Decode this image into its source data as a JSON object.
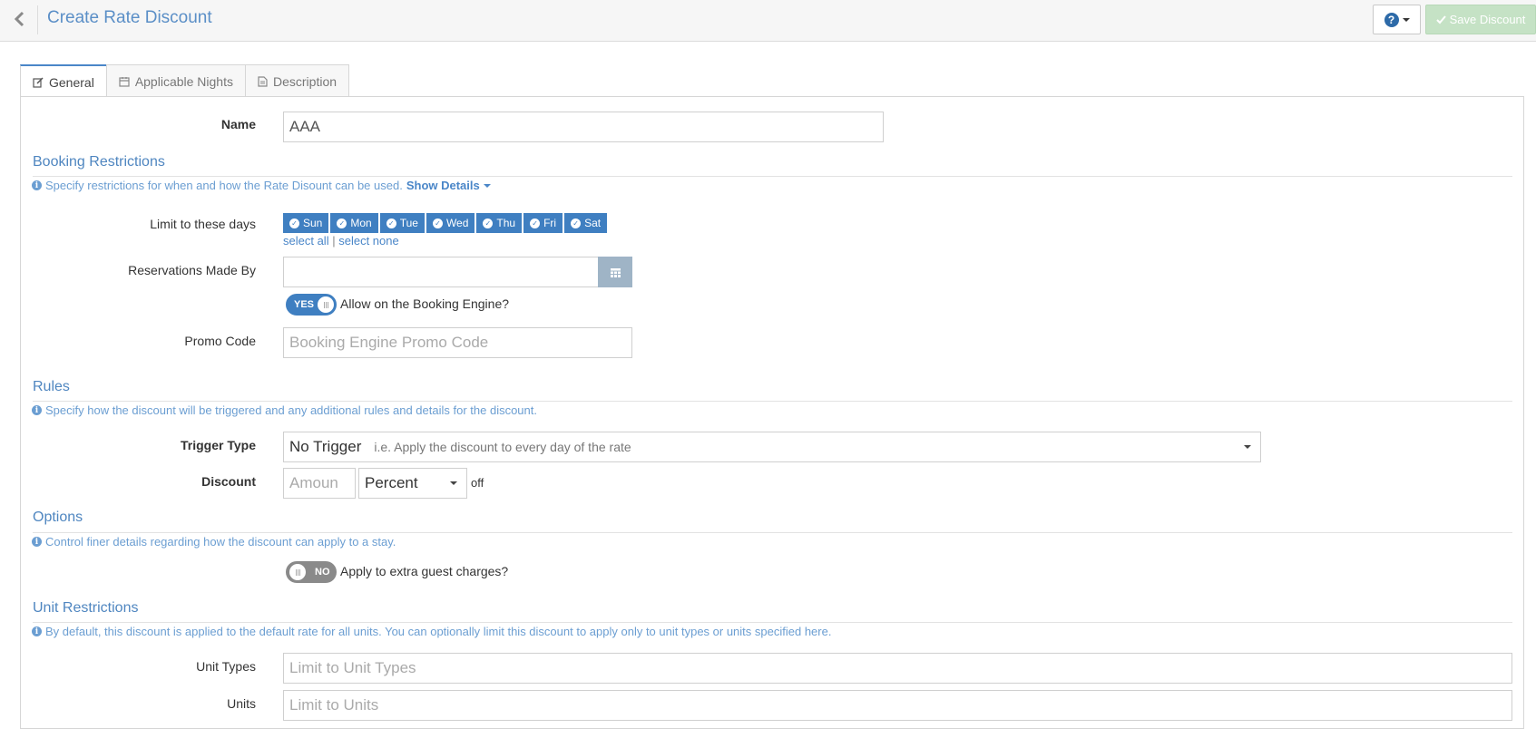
{
  "header": {
    "title": "Create Rate Discount",
    "save_label": "Save Discount"
  },
  "tabs": [
    {
      "label": "General",
      "icon": "edit-icon",
      "active": true
    },
    {
      "label": "Applicable Nights",
      "icon": "calendar-icon",
      "active": false
    },
    {
      "label": "Description",
      "icon": "document-icon",
      "active": false
    }
  ],
  "form": {
    "name_label": "Name",
    "name_value": "AAA"
  },
  "booking": {
    "title": "Booking Restrictions",
    "note": "Specify restrictions for when and how the Rate Disount can be used.",
    "show_details": "Show Details",
    "days_label": "Limit to these days",
    "days": [
      "Sun",
      "Mon",
      "Tue",
      "Wed",
      "Thu",
      "Fri",
      "Sat"
    ],
    "select_all": "select all",
    "separator": "|",
    "select_none": "select none",
    "reservations_label": "Reservations Made By",
    "reservations_value": "",
    "toggle_on": "YES",
    "allow_label": "Allow on the Booking Engine?",
    "promo_label": "Promo Code",
    "promo_placeholder": "Booking Engine Promo Code"
  },
  "rules": {
    "title": "Rules",
    "note": "Specify how the discount will be triggered and any additional rules and details for the discount.",
    "trigger_label": "Trigger Type",
    "trigger_value": "No Trigger",
    "trigger_hint": "i.e. Apply the discount to every day of the rate",
    "discount_label": "Discount",
    "amount_placeholder": "Amoun",
    "discount_type": "Percent",
    "off_label": "off"
  },
  "options": {
    "title": "Options",
    "note": "Control finer details regarding how the discount can apply to a stay.",
    "toggle_off": "NO",
    "extra_label": "Apply to extra guest charges?"
  },
  "units": {
    "title": "Unit Restrictions",
    "note": "By default, this discount is applied to the default rate for all units. You can optionally limit this discount to apply only to unit types or units specified here.",
    "types_label": "Unit Types",
    "types_placeholder": "Limit to Unit Types",
    "units_label": "Units",
    "units_placeholder": "Limit to Units"
  },
  "colors": {
    "accent": "#3f7fc1",
    "title_blue": "#5b8fc7",
    "save_disabled": "#c5e2c5"
  }
}
